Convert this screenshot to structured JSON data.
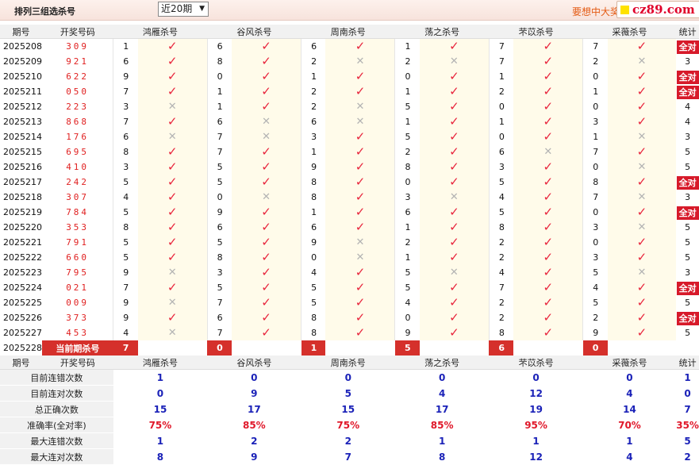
{
  "header": {
    "title": "排列三组选杀号",
    "period_select": "近20期",
    "promo": "要想中大奖",
    "brand": "cz89.com"
  },
  "table": {
    "columns": [
      "期号",
      "开奖号码",
      "鸿雁杀号",
      "谷风杀号",
      "周南杀号",
      "荡之杀号",
      "芣苡杀号",
      "采薇杀号",
      "统计"
    ],
    "rows": [
      {
        "issue": "2025208",
        "draw": "309",
        "kills": [
          {
            "d": "1",
            "ok": true
          },
          {
            "d": "6",
            "ok": true
          },
          {
            "d": "6",
            "ok": true
          },
          {
            "d": "1",
            "ok": true
          },
          {
            "d": "7",
            "ok": true
          },
          {
            "d": "7",
            "ok": true
          }
        ],
        "stat": "全对"
      },
      {
        "issue": "2025209",
        "draw": "921",
        "kills": [
          {
            "d": "6",
            "ok": true
          },
          {
            "d": "8",
            "ok": true
          },
          {
            "d": "2",
            "ok": false
          },
          {
            "d": "2",
            "ok": false
          },
          {
            "d": "7",
            "ok": true
          },
          {
            "d": "2",
            "ok": false
          }
        ],
        "stat": "3"
      },
      {
        "issue": "2025210",
        "draw": "622",
        "kills": [
          {
            "d": "9",
            "ok": true
          },
          {
            "d": "0",
            "ok": true
          },
          {
            "d": "1",
            "ok": true
          },
          {
            "d": "0",
            "ok": true
          },
          {
            "d": "1",
            "ok": true
          },
          {
            "d": "0",
            "ok": true
          }
        ],
        "stat": "全对"
      },
      {
        "issue": "2025211",
        "draw": "050",
        "kills": [
          {
            "d": "7",
            "ok": true
          },
          {
            "d": "1",
            "ok": true
          },
          {
            "d": "2",
            "ok": true
          },
          {
            "d": "1",
            "ok": true
          },
          {
            "d": "2",
            "ok": true
          },
          {
            "d": "1",
            "ok": true
          }
        ],
        "stat": "全对"
      },
      {
        "issue": "2025212",
        "draw": "223",
        "kills": [
          {
            "d": "3",
            "ok": false
          },
          {
            "d": "1",
            "ok": true
          },
          {
            "d": "2",
            "ok": false
          },
          {
            "d": "5",
            "ok": true
          },
          {
            "d": "0",
            "ok": true
          },
          {
            "d": "0",
            "ok": true
          }
        ],
        "stat": "4"
      },
      {
        "issue": "2025213",
        "draw": "868",
        "kills": [
          {
            "d": "7",
            "ok": true
          },
          {
            "d": "6",
            "ok": false
          },
          {
            "d": "6",
            "ok": false
          },
          {
            "d": "1",
            "ok": true
          },
          {
            "d": "1",
            "ok": true
          },
          {
            "d": "3",
            "ok": true
          }
        ],
        "stat": "4"
      },
      {
        "issue": "2025214",
        "draw": "176",
        "kills": [
          {
            "d": "6",
            "ok": false
          },
          {
            "d": "7",
            "ok": false
          },
          {
            "d": "3",
            "ok": true
          },
          {
            "d": "5",
            "ok": true
          },
          {
            "d": "0",
            "ok": true
          },
          {
            "d": "1",
            "ok": false
          }
        ],
        "stat": "3"
      },
      {
        "issue": "2025215",
        "draw": "695",
        "kills": [
          {
            "d": "8",
            "ok": true
          },
          {
            "d": "7",
            "ok": true
          },
          {
            "d": "1",
            "ok": true
          },
          {
            "d": "2",
            "ok": true
          },
          {
            "d": "6",
            "ok": false
          },
          {
            "d": "7",
            "ok": true
          }
        ],
        "stat": "5"
      },
      {
        "issue": "2025216",
        "draw": "410",
        "kills": [
          {
            "d": "3",
            "ok": true
          },
          {
            "d": "5",
            "ok": true
          },
          {
            "d": "9",
            "ok": true
          },
          {
            "d": "8",
            "ok": true
          },
          {
            "d": "3",
            "ok": true
          },
          {
            "d": "0",
            "ok": false
          }
        ],
        "stat": "5"
      },
      {
        "issue": "2025217",
        "draw": "242",
        "kills": [
          {
            "d": "5",
            "ok": true
          },
          {
            "d": "5",
            "ok": true
          },
          {
            "d": "8",
            "ok": true
          },
          {
            "d": "0",
            "ok": true
          },
          {
            "d": "5",
            "ok": true
          },
          {
            "d": "8",
            "ok": true
          }
        ],
        "stat": "全对"
      },
      {
        "issue": "2025218",
        "draw": "307",
        "kills": [
          {
            "d": "4",
            "ok": true
          },
          {
            "d": "0",
            "ok": false
          },
          {
            "d": "8",
            "ok": true
          },
          {
            "d": "3",
            "ok": false
          },
          {
            "d": "4",
            "ok": true
          },
          {
            "d": "7",
            "ok": false
          }
        ],
        "stat": "3"
      },
      {
        "issue": "2025219",
        "draw": "784",
        "kills": [
          {
            "d": "5",
            "ok": true
          },
          {
            "d": "9",
            "ok": true
          },
          {
            "d": "1",
            "ok": true
          },
          {
            "d": "6",
            "ok": true
          },
          {
            "d": "5",
            "ok": true
          },
          {
            "d": "0",
            "ok": true
          }
        ],
        "stat": "全对"
      },
      {
        "issue": "2025220",
        "draw": "353",
        "kills": [
          {
            "d": "8",
            "ok": true
          },
          {
            "d": "6",
            "ok": true
          },
          {
            "d": "6",
            "ok": true
          },
          {
            "d": "1",
            "ok": true
          },
          {
            "d": "8",
            "ok": true
          },
          {
            "d": "3",
            "ok": false
          }
        ],
        "stat": "5"
      },
      {
        "issue": "2025221",
        "draw": "791",
        "kills": [
          {
            "d": "5",
            "ok": true
          },
          {
            "d": "5",
            "ok": true
          },
          {
            "d": "9",
            "ok": false
          },
          {
            "d": "2",
            "ok": true
          },
          {
            "d": "2",
            "ok": true
          },
          {
            "d": "0",
            "ok": true
          }
        ],
        "stat": "5"
      },
      {
        "issue": "2025222",
        "draw": "660",
        "kills": [
          {
            "d": "5",
            "ok": true
          },
          {
            "d": "8",
            "ok": true
          },
          {
            "d": "0",
            "ok": false
          },
          {
            "d": "1",
            "ok": true
          },
          {
            "d": "2",
            "ok": true
          },
          {
            "d": "3",
            "ok": true
          }
        ],
        "stat": "5"
      },
      {
        "issue": "2025223",
        "draw": "795",
        "kills": [
          {
            "d": "9",
            "ok": false
          },
          {
            "d": "3",
            "ok": true
          },
          {
            "d": "4",
            "ok": true
          },
          {
            "d": "5",
            "ok": false
          },
          {
            "d": "4",
            "ok": true
          },
          {
            "d": "5",
            "ok": false
          }
        ],
        "stat": "3"
      },
      {
        "issue": "2025224",
        "draw": "021",
        "kills": [
          {
            "d": "7",
            "ok": true
          },
          {
            "d": "5",
            "ok": true
          },
          {
            "d": "5",
            "ok": true
          },
          {
            "d": "5",
            "ok": true
          },
          {
            "d": "7",
            "ok": true
          },
          {
            "d": "4",
            "ok": true
          }
        ],
        "stat": "全对"
      },
      {
        "issue": "2025225",
        "draw": "009",
        "kills": [
          {
            "d": "9",
            "ok": false
          },
          {
            "d": "7",
            "ok": true
          },
          {
            "d": "5",
            "ok": true
          },
          {
            "d": "4",
            "ok": true
          },
          {
            "d": "2",
            "ok": true
          },
          {
            "d": "5",
            "ok": true
          }
        ],
        "stat": "5"
      },
      {
        "issue": "2025226",
        "draw": "373",
        "kills": [
          {
            "d": "9",
            "ok": true
          },
          {
            "d": "6",
            "ok": true
          },
          {
            "d": "8",
            "ok": true
          },
          {
            "d": "0",
            "ok": true
          },
          {
            "d": "2",
            "ok": true
          },
          {
            "d": "2",
            "ok": true
          }
        ],
        "stat": "全对"
      },
      {
        "issue": "2025227",
        "draw": "453",
        "kills": [
          {
            "d": "4",
            "ok": false
          },
          {
            "d": "7",
            "ok": true
          },
          {
            "d": "8",
            "ok": true
          },
          {
            "d": "9",
            "ok": true
          },
          {
            "d": "8",
            "ok": true
          },
          {
            "d": "9",
            "ok": true
          }
        ],
        "stat": "5"
      }
    ],
    "current": {
      "issue": "2025228",
      "label": "当前期杀号",
      "kills": [
        "7",
        "0",
        "1",
        "5",
        "6",
        "0"
      ]
    },
    "summary": [
      {
        "label": "目前连错次数",
        "values": [
          "1",
          "0",
          "0",
          "0",
          "0",
          "0",
          "1"
        ],
        "red": false
      },
      {
        "label": "目前连对次数",
        "values": [
          "0",
          "9",
          "5",
          "4",
          "12",
          "4",
          "0"
        ],
        "red": false
      },
      {
        "label": "总正确次数",
        "values": [
          "15",
          "17",
          "15",
          "17",
          "19",
          "14",
          "7"
        ],
        "red": false
      },
      {
        "label": "准确率(全对率)",
        "values": [
          "75%",
          "85%",
          "75%",
          "85%",
          "95%",
          "70%",
          "35%"
        ],
        "red": true
      },
      {
        "label": "最大连错次数",
        "values": [
          "1",
          "2",
          "2",
          "1",
          "1",
          "1",
          "5"
        ],
        "red": false
      },
      {
        "label": "最大连对次数",
        "values": [
          "8",
          "9",
          "7",
          "8",
          "12",
          "4",
          "2"
        ],
        "red": false
      }
    ],
    "icons": {
      "hit": "check-icon",
      "miss": "cross-icon"
    },
    "colors": {
      "accent": "#d5302b",
      "check": "#e8243c",
      "cross": "#b3b3b3",
      "summary_value": "#1b22b8"
    }
  }
}
